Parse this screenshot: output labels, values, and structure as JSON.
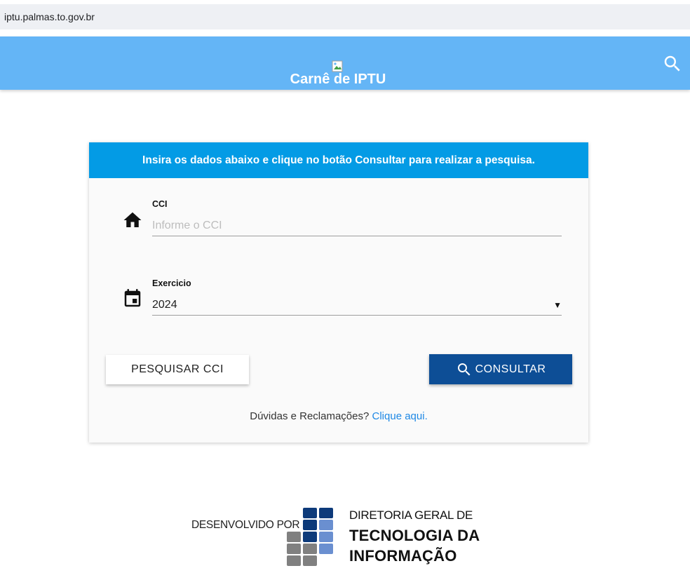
{
  "browser": {
    "url": "iptu.palmas.to.gov.br"
  },
  "appbar": {
    "title": "Carnê de IPTU",
    "logo_icon": "broken-image-icon",
    "search_icon": "search-icon",
    "color": "#64b5f6"
  },
  "card": {
    "header": "Insira os dados abaixo e clique no botão Consultar para realizar a pesquisa.",
    "header_color": "#039be5",
    "cci": {
      "icon": "home-icon",
      "label": "CCI",
      "placeholder": "Informe o CCI",
      "value": ""
    },
    "exercicio": {
      "icon": "calendar-icon",
      "label": "Exercicio",
      "selected": "2024",
      "caret": "▼"
    },
    "buttons": {
      "pesquisar": "PESQUISAR CCI",
      "consultar": "CONSULTAR",
      "consultar_color": "#0d4e96"
    },
    "help": {
      "text": "Dúvidas e Reclamações?",
      "link": "Clique aqui."
    }
  },
  "footer": {
    "developed_by": "DESENVOLVIDO POR",
    "org_line1": "DIRETORIA GERAL DE",
    "org_line2": "TECNOLOGIA DA",
    "org_line3": "INFORMAÇÃO",
    "logo_icon": "dgti-logo-icon"
  }
}
